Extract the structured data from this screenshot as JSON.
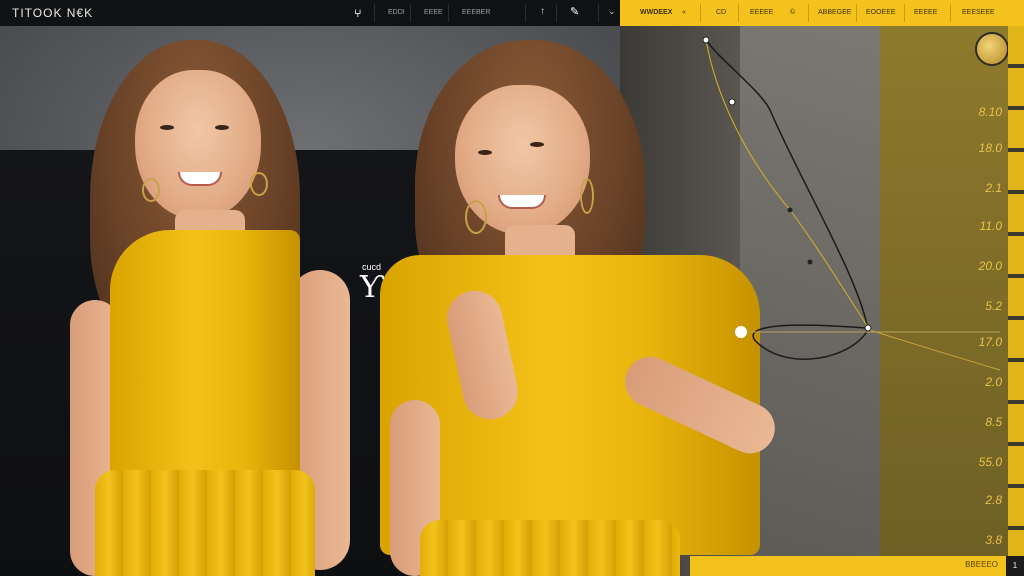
{
  "app": {
    "title": "TITOOK N€K"
  },
  "toolbar": {
    "items": [
      {
        "label": "ⵖ",
        "icon": "brush-icon"
      },
      {
        "label": "EDDI"
      },
      {
        "label": "EEEE"
      },
      {
        "label": "EEEBER"
      },
      {
        "label": "↑"
      },
      {
        "label": "✎",
        "icon": "pen-icon"
      },
      {
        "label": "⌄"
      }
    ]
  },
  "panel_header": {
    "items": [
      {
        "label": "WWDEEX"
      },
      {
        "label": "«"
      },
      {
        "label": "CD"
      },
      {
        "label": "EEEEE"
      },
      {
        "label": "©"
      },
      {
        "label": "ABBEGEE"
      },
      {
        "label": "EOOEEE"
      },
      {
        "label": "EEEEE"
      },
      {
        "label": "EEESEEE"
      }
    ]
  },
  "scale": {
    "labels": [
      "8.10",
      "18.0",
      "2.1",
      "11.0",
      "20.0",
      "5.2",
      "17.0",
      "2.0",
      "8.5",
      "55.0",
      "2.8",
      "3.8"
    ]
  },
  "cursor": {
    "label": "cucd",
    "glyph": "Ƴ"
  },
  "bottom_bar": {
    "label": "BBEEEO",
    "end": "1"
  },
  "colors": {
    "accent": "#f4c21d",
    "topbar": "#101112"
  }
}
